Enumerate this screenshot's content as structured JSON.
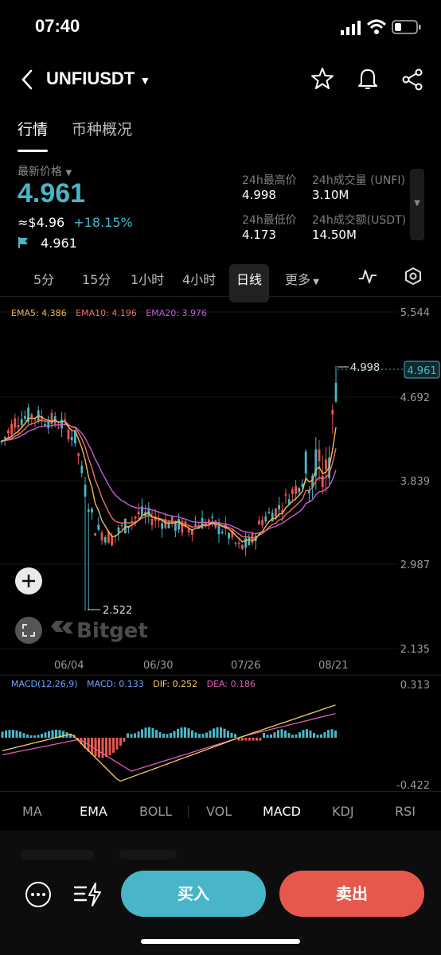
{
  "status": {
    "time": "07:40"
  },
  "header": {
    "pair": "UNFIUSDT"
  },
  "tabs": [
    "行情",
    "币种概况"
  ],
  "price": {
    "label": "最新价格",
    "last": "4.961",
    "usd": "≈$4.96",
    "change": "+18.15%",
    "mark": "4.961"
  },
  "stats": {
    "high_label": "24h最高价",
    "high": "4.998",
    "low_label": "24h最低价",
    "low": "4.173",
    "vol_label": "24h成交量 (UNFI)",
    "vol": "3.10M",
    "amt_label": "24h成交额(USDT)",
    "amt": "14.50M"
  },
  "timeframes": [
    "5分",
    "15分",
    "1小时",
    "4小时",
    "日线",
    "更多"
  ],
  "timeframe_selected": "日线",
  "chart": {
    "ema": {
      "ema5": "EMA5: 4.386",
      "ema10": "EMA10: 4.196",
      "ema20": "EMA20: 3.976"
    },
    "y_ticks": [
      "5.544",
      "4.692",
      "3.839",
      "2.987",
      "2.135"
    ],
    "x_ticks": [
      "06/04",
      "06/30",
      "07/26",
      "08/21"
    ],
    "high_mark": "4.998",
    "low_mark": "2.522",
    "last_tag": "4.961",
    "watermark": "Bitget",
    "colors": {
      "up": "#48b6c8",
      "down": "#e8574c",
      "ema5": "#f0b957",
      "ema10": "#f06d6d",
      "ema20": "#c35fd8"
    }
  },
  "macd": {
    "label": "MACD(12,26,9)",
    "macd": "MACD: 0.133",
    "dif": "DIF: 0.252",
    "dea": "DEA: 0.186",
    "y_top": "0.313",
    "y_bottom": "-0.422"
  },
  "indicators": [
    "MA",
    "EMA",
    "BOLL",
    "VOL",
    "MACD",
    "KDJ",
    "RSI"
  ],
  "indicators_active": [
    "EMA",
    "MACD"
  ],
  "actions": {
    "buy": "买入",
    "sell": "卖出"
  }
}
